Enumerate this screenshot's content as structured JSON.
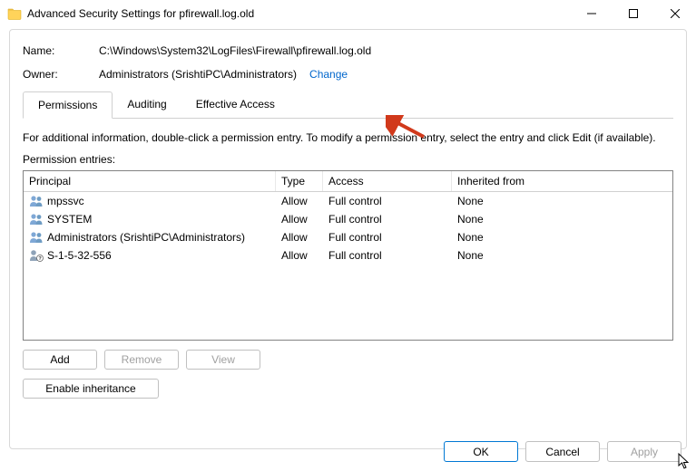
{
  "window": {
    "title": "Advanced Security Settings for pfirewall.log.old"
  },
  "fields": {
    "name_label": "Name:",
    "name_value": "C:\\Windows\\System32\\LogFiles\\Firewall\\pfirewall.log.old",
    "owner_label": "Owner:",
    "owner_value": "Administrators (SrishtiPC\\Administrators)",
    "change_link": "Change"
  },
  "tabs": {
    "permissions": "Permissions",
    "auditing": "Auditing",
    "effective": "Effective Access"
  },
  "info_text": "For additional information, double-click a permission entry. To modify a permission entry, select the entry and click Edit (if available).",
  "entries_label": "Permission entries:",
  "table": {
    "headers": {
      "principal": "Principal",
      "type": "Type",
      "access": "Access",
      "inherited": "Inherited from"
    },
    "rows": [
      {
        "icon": "group",
        "principal": "mpssvc",
        "type": "Allow",
        "access": "Full control",
        "inherited": "None"
      },
      {
        "icon": "group",
        "principal": "SYSTEM",
        "type": "Allow",
        "access": "Full control",
        "inherited": "None"
      },
      {
        "icon": "group",
        "principal": "Administrators (SrishtiPC\\Administrators)",
        "type": "Allow",
        "access": "Full control",
        "inherited": "None"
      },
      {
        "icon": "unknown",
        "principal": "S-1-5-32-556",
        "type": "Allow",
        "access": "Full control",
        "inherited": "None"
      }
    ]
  },
  "buttons": {
    "add": "Add",
    "remove": "Remove",
    "view": "View",
    "enable_inheritance": "Enable inheritance",
    "ok": "OK",
    "cancel": "Cancel",
    "apply": "Apply"
  }
}
